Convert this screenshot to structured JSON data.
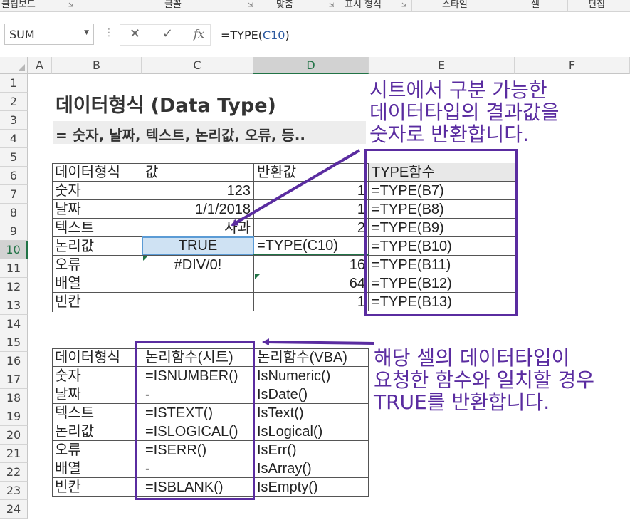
{
  "ribbon": {
    "groups": [
      "클립보드",
      "글꼴",
      "맞춤",
      "표시 형식",
      "스타일",
      "셀",
      "편집"
    ]
  },
  "formula_bar": {
    "name_box": "SUM",
    "formula_prefix": "=TYPE(",
    "formula_ref": "C10",
    "formula_suffix": ")"
  },
  "columns": [
    "A",
    "B",
    "C",
    "D",
    "E",
    "F"
  ],
  "rows": [
    "1",
    "2",
    "3",
    "4",
    "5",
    "6",
    "7",
    "8",
    "9",
    "10",
    "11",
    "12",
    "13",
    "14",
    "15",
    "16",
    "17",
    "18",
    "19",
    "20",
    "21",
    "22",
    "23",
    "24"
  ],
  "sheet": {
    "title": "데이터형식 (Data Type)",
    "subtitle": "= 숫자, 날짜, 텍스트, 논리값, 오류, 등..",
    "type_table": {
      "headers": [
        "데이터형식",
        "값",
        "반환값",
        "TYPE함수"
      ],
      "rows": [
        {
          "type": "숫자",
          "value": "123",
          "result": "1",
          "formula": "=TYPE(B7)"
        },
        {
          "type": "날짜",
          "value": "1/1/2018",
          "result": "1",
          "formula": "=TYPE(B8)"
        },
        {
          "type": "텍스트",
          "value": "사과",
          "result": "2",
          "formula": "=TYPE(B9)"
        },
        {
          "type": "논리값",
          "value": "TRUE",
          "result": "=TYPE(C10)",
          "formula": "=TYPE(B10)"
        },
        {
          "type": "오류",
          "value": "#DIV/0!",
          "result": "16",
          "formula": "=TYPE(B11)"
        },
        {
          "type": "배열",
          "value": "",
          "result": "64",
          "formula": "=TYPE(B12)"
        },
        {
          "type": "빈칸",
          "value": "",
          "result": "1",
          "formula": "=TYPE(B13)"
        }
      ]
    },
    "is_table": {
      "headers": [
        "데이터형식",
        "논리함수(시트)",
        "논리함수(VBA)"
      ],
      "rows": [
        {
          "type": "숫자",
          "sheet_fn": "=ISNUMBER()",
          "vba_fn": "IsNumeric()"
        },
        {
          "type": "날짜",
          "sheet_fn": "-",
          "vba_fn": "IsDate()"
        },
        {
          "type": "텍스트",
          "sheet_fn": "=ISTEXT()",
          "vba_fn": "IsText()"
        },
        {
          "type": "논리값",
          "sheet_fn": "=ISLOGICAL()",
          "vba_fn": "IsLogical()"
        },
        {
          "type": "오류",
          "sheet_fn": "=ISERR()",
          "vba_fn": "IsErr()"
        },
        {
          "type": "배열",
          "sheet_fn": "-",
          "vba_fn": "IsArray()"
        },
        {
          "type": "빈칸",
          "sheet_fn": "=ISBLANK()",
          "vba_fn": "IsEmpty()"
        }
      ]
    }
  },
  "annotations": {
    "callout1": [
      "시트에서 구분 가능한",
      "데이터타입의 결과값을",
      "숫자로 반환합니다."
    ],
    "callout2": [
      "해당 셀의 데이터타입이",
      "요청한 함수와 일치할 경우",
      "TRUE를 반환합니다."
    ]
  },
  "colors": {
    "accent_purple": "#5a2ca0",
    "excel_green": "#217346",
    "selection_blue": "#cfe2f3"
  }
}
